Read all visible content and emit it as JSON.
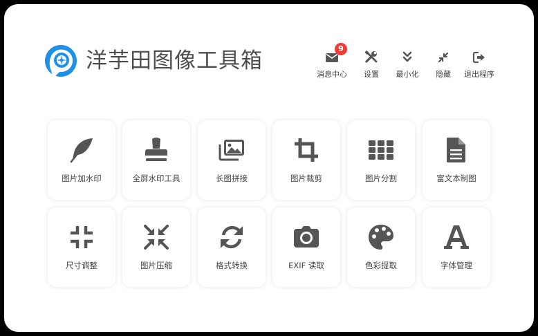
{
  "app": {
    "title": "洋芋田图像工具箱",
    "accent": "#1e90e8",
    "icon_color": "#555555"
  },
  "toolbar": {
    "messages": {
      "label": "消息中心",
      "badge": "9",
      "icon": "envelope-icon"
    },
    "settings": {
      "label": "设置",
      "icon": "tools-icon"
    },
    "minimize": {
      "label": "最小化",
      "icon": "chevron-double-down-icon"
    },
    "hide": {
      "label": "隐藏",
      "icon": "compress-arrows-icon"
    },
    "exit": {
      "label": "退出程序",
      "icon": "sign-out-icon"
    }
  },
  "tools": [
    {
      "label": "图片加水印",
      "icon": "feather-icon"
    },
    {
      "label": "全屏水印工具",
      "icon": "stamp-icon"
    },
    {
      "label": "长图拼接",
      "icon": "images-icon"
    },
    {
      "label": "图片裁剪",
      "icon": "crop-icon"
    },
    {
      "label": "图片分割",
      "icon": "grid-icon"
    },
    {
      "label": "富文本制图",
      "icon": "document-icon"
    },
    {
      "label": "尺寸调整",
      "icon": "compress-icon"
    },
    {
      "label": "图片压缩",
      "icon": "compress-arrows-icon"
    },
    {
      "label": "格式转换",
      "icon": "sync-icon"
    },
    {
      "label": "EXIF 读取",
      "icon": "camera-icon"
    },
    {
      "label": "色彩提取",
      "icon": "palette-icon"
    },
    {
      "label": "字体管理",
      "icon": "font-icon"
    }
  ]
}
